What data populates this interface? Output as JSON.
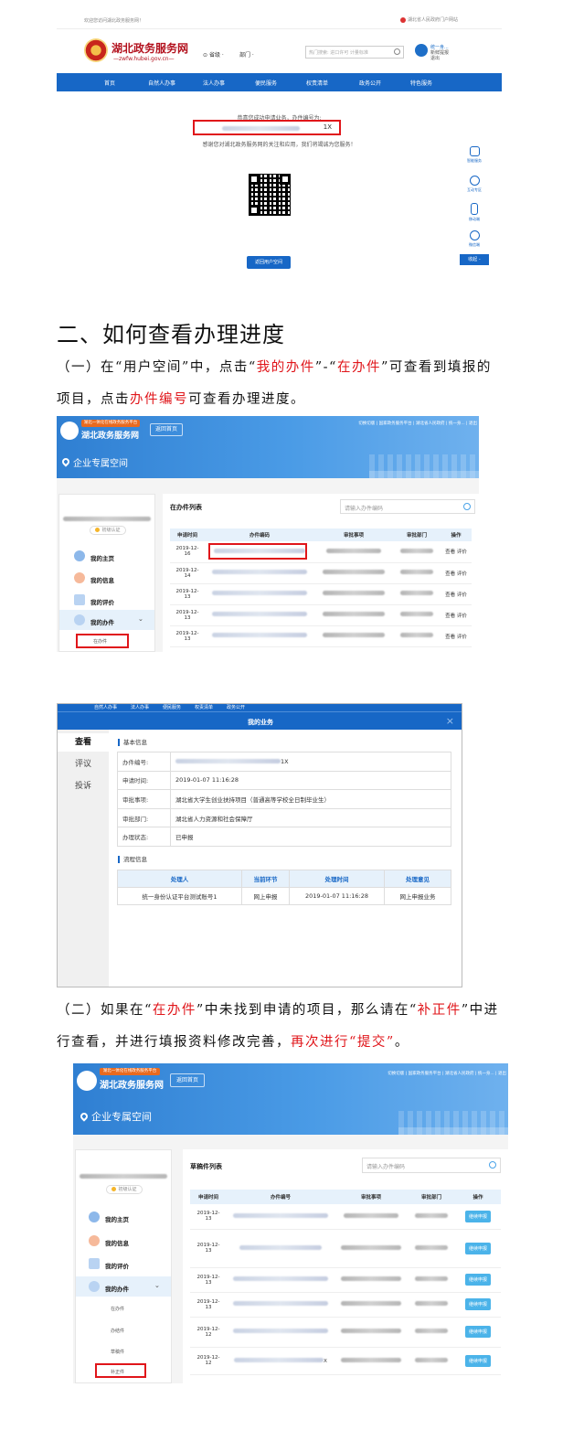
{
  "section1": {
    "top_left": "欢迎您访问湖北政务服务网！",
    "top_right": "湖北省人民政府门户网站",
    "site_title": "湖北政务服务网",
    "site_domain": "—zwfw.hubei.gov.cn—",
    "region_select": "省级 ·",
    "dept_select": "部门 ·",
    "search_placeholder": "热门搜索: 进口许可 计量标准",
    "user_name": "统一身...",
    "user_sub": "新鲜提报",
    "user_logout": "退出",
    "nav": [
      "首页",
      "自然人办事",
      "法人办事",
      "便民服务",
      "权责清单",
      "政务公开",
      "特色服务"
    ],
    "success_msg": "恭喜您成功申请业务，办件编号为:",
    "case_number_tail": "1X",
    "thanks_msg": "感谢您对湖北政务服务网的关注和应用，我们将竭诚为您服务！",
    "back_button": "返回用户空间",
    "side_tools": [
      "智能服务",
      "互动专区",
      "移动端",
      "微信端"
    ],
    "side_top": "收起 -"
  },
  "heading": "二、如何查看办理进度",
  "para1": {
    "a": "（一）在“用户空间”中，点击“",
    "b": "我的办件",
    "c": "”-“",
    "d": "在办件",
    "e": "”可查看到填报的",
    "f": "项目，点击",
    "g": "办件编号",
    "h": "可查看办理进度。"
  },
  "portal1": {
    "tag": "湖北一体化在线政务服务平台",
    "brand": "湖北政务服务网",
    "home_btn": "返回首页",
    "links": "切换切版 | 国家政务服务平台 | 湖北省人民政府 | 统一身... | 退出",
    "space_title": "企业专属空间",
    "badge": "初级认证",
    "menu": [
      "我的主页",
      "我的信息",
      "我的评价",
      "我的办件"
    ],
    "submenu_active": "在办件",
    "list_title": "在办件列表",
    "search_placeholder": "请输入办件编码",
    "columns": [
      "申请时间",
      "办件编码",
      "审批事项",
      "审批部门",
      "操作"
    ],
    "rows": [
      {
        "date": "2019-12-\n16",
        "op": "查看 评价"
      },
      {
        "date": "2019-12-\n14",
        "op": "查看 评价"
      },
      {
        "date": "2019-12-\n13",
        "op": "查看 评价"
      },
      {
        "date": "2019-12-\n13",
        "op": "查看 评价"
      },
      {
        "date": "2019-12-\n13",
        "op": "查看 评价"
      }
    ]
  },
  "dialog": {
    "bg_nav": "自然人办事　　　法人办事　　　便民服务　　　权责清单　　　政务公开",
    "title": "我的业务",
    "close": "×",
    "tabs": [
      "查看",
      "评议",
      "投诉"
    ],
    "basic_title": "基本信息",
    "basic": [
      {
        "k": "办件编号:",
        "v": "1X"
      },
      {
        "k": "申请时间:",
        "v": "2019-01-07 11:16:28"
      },
      {
        "k": "审批事项:",
        "v": "湖北省大学生创业扶持项目（普通高等学校全日制毕业生）"
      },
      {
        "k": "审批部门:",
        "v": "湖北省人力资源和社会保障厅"
      },
      {
        "k": "办理状态:",
        "v": "已申报"
      }
    ],
    "flow_title": "流程信息",
    "flow_columns": [
      "处理人",
      "当前环节",
      "处理时间",
      "处理意见"
    ],
    "flow_row": [
      "统一身份认证平台测试账号1",
      "网上申报",
      "2019-01-07 11:16:28",
      "网上申报业务"
    ]
  },
  "para2": {
    "a": "（二）如果在“",
    "b": "在办件",
    "c": "”中未找到申请的项目，那么请在“",
    "d": "补正件",
    "e": "”中进",
    "f": "行查看，并进行填报资料修改完善，",
    "g": "再次进行“提交”",
    "h": "。"
  },
  "portal2": {
    "tag": "湖北一体化在线政务服务平台",
    "brand": "湖北政务服务网",
    "home_btn": "返回首页",
    "links": "切换切版 | 国家政务服务平台 | 湖北省人民政府 | 统一身... | 退出",
    "space_title": "企业专属空间",
    "badge": "初级认证",
    "menu": [
      "我的主页",
      "我的信息",
      "我的评价",
      "我的办件"
    ],
    "submenu": [
      "在办件",
      "办结件",
      "草稿件",
      "补正件"
    ],
    "list_title": "草稿件列表",
    "search_placeholder": "请输入办件编码",
    "columns": [
      "申请时间",
      "办件编号",
      "审批事项",
      "审批部门",
      "操作"
    ],
    "rows": [
      {
        "date": "2019-12-\n13",
        "op": "继续申报"
      },
      {
        "date": "2019-12-\n13",
        "op": "继续申报"
      },
      {
        "date": "2019-12-\n13",
        "op": "继续申报"
      },
      {
        "date": "2019-12-\n13",
        "op": "继续申报"
      },
      {
        "date": "2019-12-\n12",
        "op": "继续申报"
      },
      {
        "date": "2019-12-\n12",
        "op": "继续申报"
      }
    ],
    "last_code_tail": "X"
  }
}
